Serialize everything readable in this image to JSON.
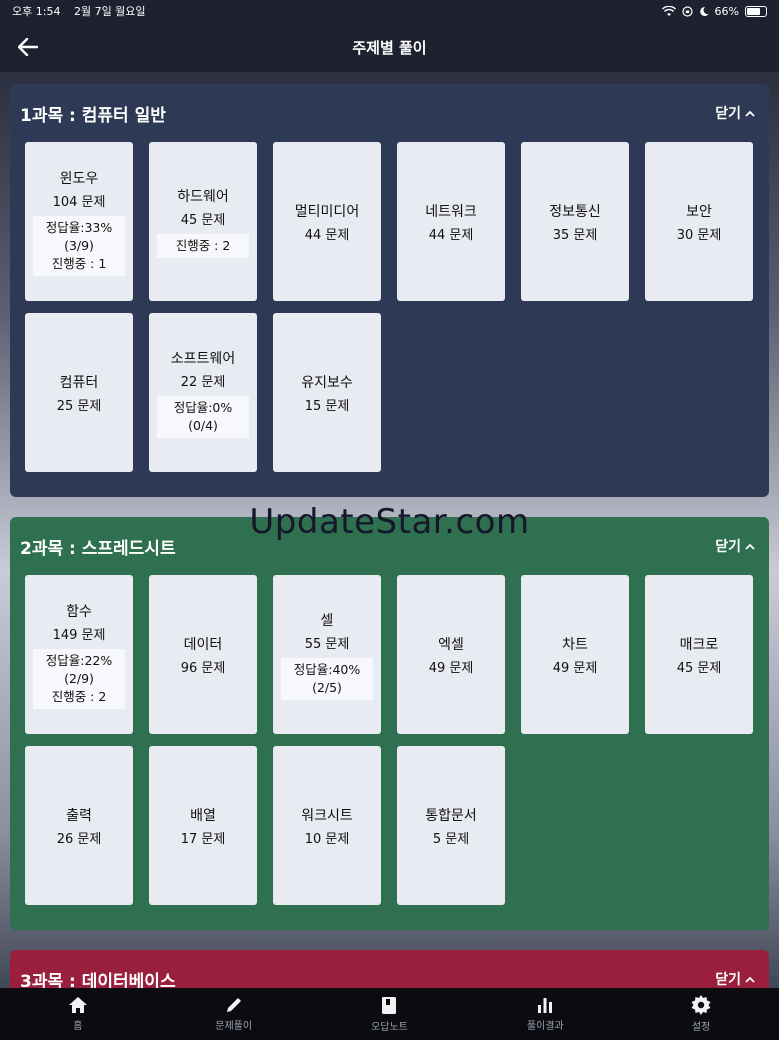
{
  "status_bar": {
    "time": "오후 1:54",
    "date": "2월 7일 월요일",
    "battery": "66%"
  },
  "header": {
    "title": "주제별 풀이"
  },
  "close_label": "닫기",
  "sections": [
    {
      "title": "1과목 : 컴퓨터 일반",
      "color": "#2e3a55",
      "topics": [
        {
          "name": "윈도우",
          "count": "104 문제",
          "stats": [
            "정답율:33%",
            "(3/9)",
            "진행중 : 1"
          ]
        },
        {
          "name": "하드웨어",
          "count": "45 문제",
          "stats": [
            "진행중 : 2"
          ]
        },
        {
          "name": "멀티미디어",
          "count": "44 문제",
          "stats": []
        },
        {
          "name": "네트워크",
          "count": "44 문제",
          "stats": []
        },
        {
          "name": "정보통신",
          "count": "35 문제",
          "stats": []
        },
        {
          "name": "보안",
          "count": "30 문제",
          "stats": []
        },
        {
          "name": "컴퓨터",
          "count": "25 문제",
          "stats": []
        },
        {
          "name": "소프트웨어",
          "count": "22 문제",
          "stats": [
            "정답율:0%",
            "(0/4)"
          ]
        },
        {
          "name": "유지보수",
          "count": "15 문제",
          "stats": []
        }
      ]
    },
    {
      "title": "2과목 : 스프레드시트",
      "color": "#2f7050",
      "topics": [
        {
          "name": "함수",
          "count": "149 문제",
          "stats": [
            "정답율:22%",
            "(2/9)",
            "진행중 : 2"
          ]
        },
        {
          "name": "데이터",
          "count": "96 문제",
          "stats": []
        },
        {
          "name": "셀",
          "count": "55 문제",
          "stats": [
            "정답율:40%",
            "(2/5)"
          ]
        },
        {
          "name": "엑셀",
          "count": "49 문제",
          "stats": []
        },
        {
          "name": "차트",
          "count": "49 문제",
          "stats": []
        },
        {
          "name": "매크로",
          "count": "45 문제",
          "stats": []
        },
        {
          "name": "출력",
          "count": "26 문제",
          "stats": []
        },
        {
          "name": "배열",
          "count": "17 문제",
          "stats": []
        },
        {
          "name": "워크시트",
          "count": "10 문제",
          "stats": []
        },
        {
          "name": "통합문서",
          "count": "5 문제",
          "stats": []
        }
      ]
    },
    {
      "title": "3과목 : 데이터베이스",
      "color": "#9a1f3d",
      "topics": []
    }
  ],
  "watermark": "UpdateStar.com",
  "bottom_nav": [
    {
      "label": "홈",
      "icon": "home-icon"
    },
    {
      "label": "문제풀이",
      "icon": "pencil-icon"
    },
    {
      "label": "오답노트",
      "icon": "notebook-icon"
    },
    {
      "label": "풀이결과",
      "icon": "bar-chart-icon"
    },
    {
      "label": "설정",
      "icon": "gear-icon"
    }
  ]
}
